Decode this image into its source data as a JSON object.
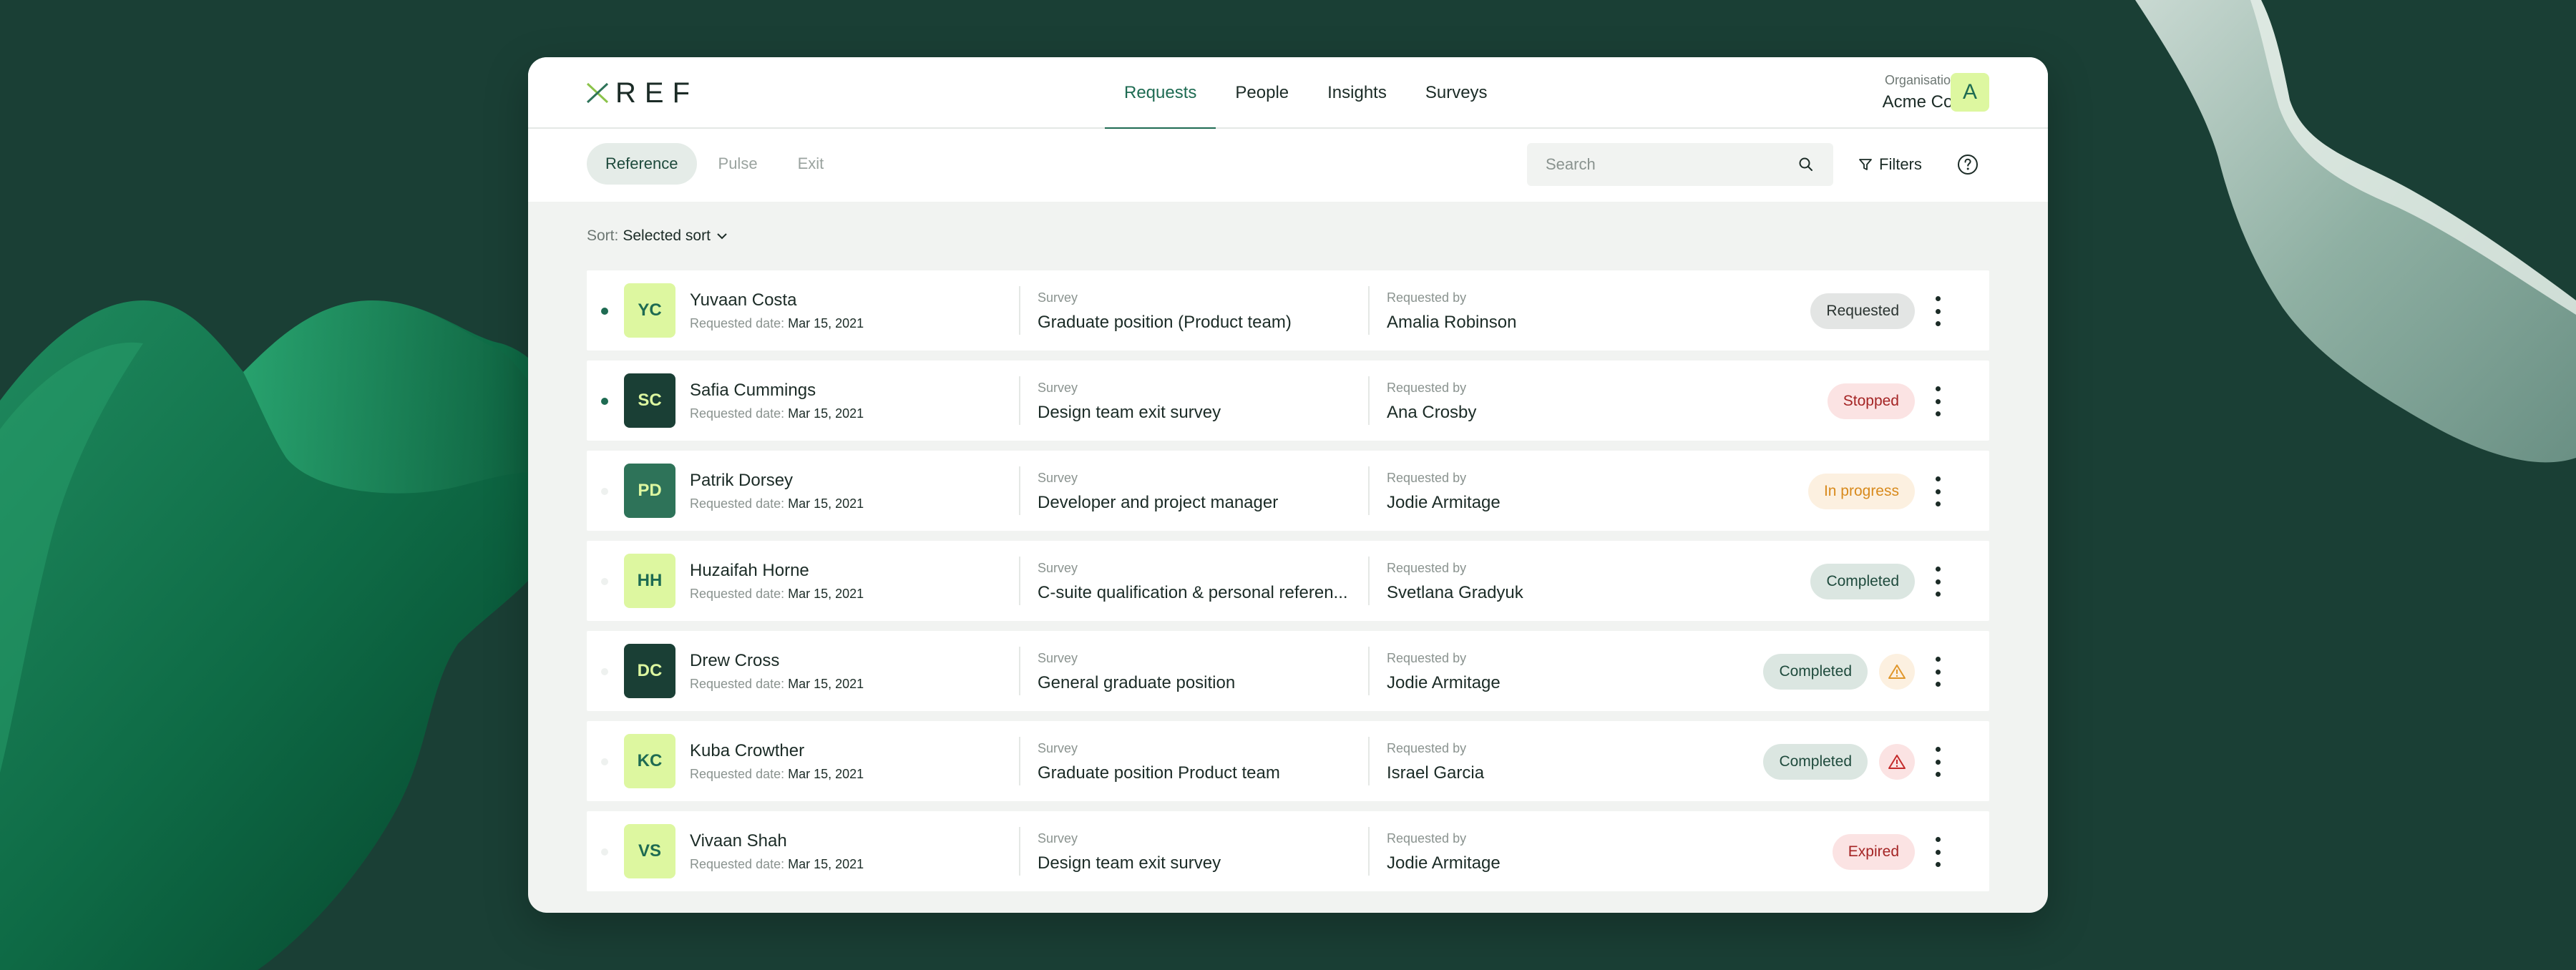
{
  "brand": {
    "name": "REF",
    "accent": "#8bc34a"
  },
  "colors": {
    "background": "#1a3f35",
    "primary": "#1e6b52",
    "highlight": "#ddf7a0"
  },
  "nav": {
    "items": [
      {
        "label": "Requests",
        "active": true
      },
      {
        "label": "People",
        "active": false
      },
      {
        "label": "Insights",
        "active": false
      },
      {
        "label": "Surveys",
        "active": false
      }
    ]
  },
  "org": {
    "label": "Organisation",
    "name": "Acme Co.",
    "avatar": "A"
  },
  "subtabs": [
    {
      "label": "Reference",
      "active": true
    },
    {
      "label": "Pulse",
      "active": false
    },
    {
      "label": "Exit",
      "active": false
    }
  ],
  "search": {
    "placeholder": "Search",
    "value": "",
    "icon": "search-icon"
  },
  "filters": {
    "label": "Filters",
    "icon": "filter-icon"
  },
  "help": {
    "icon": "help-icon"
  },
  "sort": {
    "label": "Sort:",
    "value": "Selected sort"
  },
  "columns": {
    "survey": "Survey",
    "requested_by": "Requested by",
    "date_label": "Requested date:"
  },
  "rows": [
    {
      "initials": "YC",
      "name": "Yuvaan Costa",
      "date": "Mar 15, 2021",
      "survey": "Graduate position (Product team)",
      "requested_by": "Amalia Robinson",
      "status": "Requested",
      "unread": true,
      "avatar_style": "light",
      "warning": null
    },
    {
      "initials": "SC",
      "name": "Safia Cummings",
      "date": "Mar 15, 2021",
      "survey": "Design team exit survey",
      "requested_by": "Ana Crosby",
      "status": "Stopped",
      "unread": true,
      "avatar_style": "dark",
      "warning": null
    },
    {
      "initials": "PD",
      "name": "Patrik Dorsey",
      "date": "Mar 15, 2021",
      "survey": "Developer and project manager",
      "requested_by": "Jodie Armitage",
      "status": "In progress",
      "unread": false,
      "avatar_style": "mid",
      "warning": null
    },
    {
      "initials": "HH",
      "name": "Huzaifah Horne",
      "date": "Mar 15, 2021",
      "survey": "C-suite qualification & personal referen...",
      "requested_by": "Svetlana Gradyuk",
      "status": "Completed",
      "unread": false,
      "avatar_style": "light",
      "warning": null
    },
    {
      "initials": "DC",
      "name": "Drew Cross",
      "date": "Mar 15, 2021",
      "survey": "General graduate position",
      "requested_by": "Jodie Armitage",
      "status": "Completed",
      "unread": false,
      "avatar_style": "dark",
      "warning": "orange"
    },
    {
      "initials": "KC",
      "name": "Kuba Crowther",
      "date": "Mar 15, 2021",
      "survey": "Graduate position Product team",
      "requested_by": "Israel Garcia",
      "status": "Completed",
      "unread": false,
      "avatar_style": "light",
      "warning": "red"
    },
    {
      "initials": "VS",
      "name": "Vivaan Shah",
      "date": "Mar 15, 2021",
      "survey": "Design team exit survey",
      "requested_by": "Jodie Armitage",
      "status": "Expired",
      "unread": false,
      "avatar_style": "light",
      "warning": null
    }
  ]
}
